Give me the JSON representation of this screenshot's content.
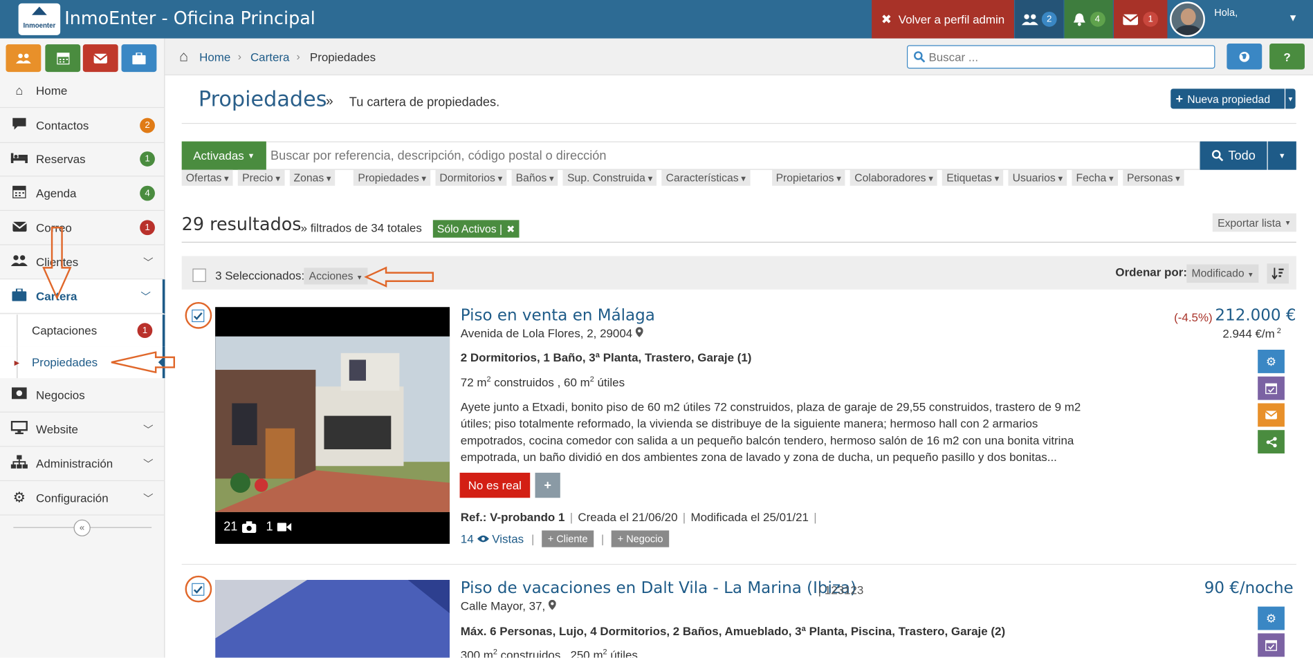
{
  "topbar": {
    "logo_text": "Inmoenter",
    "title": "InmoEnter - Oficina Principal",
    "back_admin": "Volver a perfil admin",
    "users_count": "2",
    "notif_count": "4",
    "mail_count": "1",
    "greeting": "Hola,",
    "colors": {
      "bar": "#2d6b94",
      "admin": "#a83228",
      "users": "#255477",
      "notif": "#3e7d3e",
      "mail": "#a83228"
    }
  },
  "quick_buttons": [
    {
      "icon": "users-icon",
      "color": "#e8902a"
    },
    {
      "icon": "calendar-icon",
      "color": "#4a8c3f"
    },
    {
      "icon": "envelope-icon",
      "color": "#c0392b"
    },
    {
      "icon": "briefcase-icon",
      "color": "#3a87c4"
    }
  ],
  "sidebar": {
    "items": [
      {
        "label": "Home",
        "icon": "home-icon"
      },
      {
        "label": "Contactos",
        "icon": "comment-icon",
        "badge": "2",
        "badge_color": "#e07b16"
      },
      {
        "label": "Reservas",
        "icon": "bed-icon",
        "badge": "1",
        "badge_color": "#4a8c3f"
      },
      {
        "label": "Agenda",
        "icon": "calendar-icon",
        "badge": "4",
        "badge_color": "#4a8c3f"
      },
      {
        "label": "Correo",
        "icon": "envelope-icon",
        "badge": "1",
        "badge_color": "#b9312b"
      },
      {
        "label": "Clientes",
        "icon": "users-icon"
      },
      {
        "label": "Cartera",
        "icon": "briefcase-icon"
      },
      {
        "label": "Negocios",
        "icon": "dollar-icon"
      },
      {
        "label": "Website",
        "icon": "desktop-icon"
      },
      {
        "label": "Administración",
        "icon": "sitemap-icon"
      },
      {
        "label": "Configuración",
        "icon": "cogs-icon"
      }
    ],
    "sub": [
      {
        "label": "Captaciones",
        "badge": "1"
      },
      {
        "label": "Propiedades"
      }
    ]
  },
  "breadcrumb": {
    "home": "Home",
    "cartera": "Cartera",
    "current": "Propiedades"
  },
  "search": {
    "placeholder": "Buscar ..."
  },
  "page": {
    "title": "Propiedades",
    "sep": "»",
    "subtitle": "Tu cartera de propiedades.",
    "new_button": "Nueva propiedad"
  },
  "filterbar": {
    "status": "Activadas",
    "search_placeholder": "Buscar por referencia, descripción, código postal o dirección",
    "search_button": "Todo",
    "group1": [
      "Ofertas",
      "Precio",
      "Zonas"
    ],
    "group2": [
      "Propiedades",
      "Dormitorios",
      "Baños",
      "Sup. Construida",
      "Características"
    ],
    "group3": [
      "Propietarios",
      "Colaboradores",
      "Etiquetas",
      "Usuarios",
      "Fecha",
      "Personas"
    ]
  },
  "results": {
    "count": "29 resultados",
    "filtered": "» filtrados de 34 totales",
    "tag": "Sólo Activos |",
    "export": "Exportar lista"
  },
  "selection": {
    "text": "3 Seleccionados:",
    "actions": "Acciones",
    "order_label": "Ordenar por:",
    "order_value": "Modificado"
  },
  "listings": [
    {
      "title": "Piso en venta en Málaga",
      "address": "Avenida de Lola Flores, 2, 29004",
      "features": "2 Dormitorios, 1 Baño, 3ª Planta, Trastero, Garaje (1)",
      "area_built": "72 m",
      "area_built_sfx": " construidos , 60 m",
      "area_useful_sfx": " útiles",
      "description": "Ayete junto a Etxadi, bonito piso de 60 m2 útiles 72 construidos, plaza de garaje de 29,55 construidos, trastero de 9 m2 útiles; piso totalmente reformado, la vivienda se distribuye de la siguiente manera; hermoso hall con 2 armarios empotrados, cocina comedor con salida a un pequeño balcón tendero, hermoso salón de 16 m2 con una bonita vitrina empotrada, un baño dividió en dos ambientes zona de lavado y zona de ducha, un pequeño pasillo y dos bonitas...",
      "tag": "No es real",
      "ref": "Ref.: V-probando 1",
      "created": "Creada el 21/06/20",
      "modified": "Modificada el 25/01/21",
      "views": "14",
      "views_label": "Vistas",
      "client_btn": "Cliente",
      "deal_btn": "Negocio",
      "photos": "21",
      "videos": "1",
      "price_change": "(-4.5%)",
      "price": "212.000 €",
      "price_m2": "2.944 €/m"
    },
    {
      "title": "Piso de vacaciones en Dalt Vila - La Marina (Ibiza)",
      "ref_inline": "| 123123",
      "address": "Calle Mayor, 37,",
      "features": "Máx. 6 Personas, Lujo, 4 Dormitorios, 2 Baños, Amueblado, 3ª Planta, Piscina, Trastero, Garaje (2)",
      "area_built": "300 m",
      "area_built_sfx": " construidos , 250 m",
      "area_useful_sfx": " útiles",
      "price": "90 €/noche"
    }
  ]
}
